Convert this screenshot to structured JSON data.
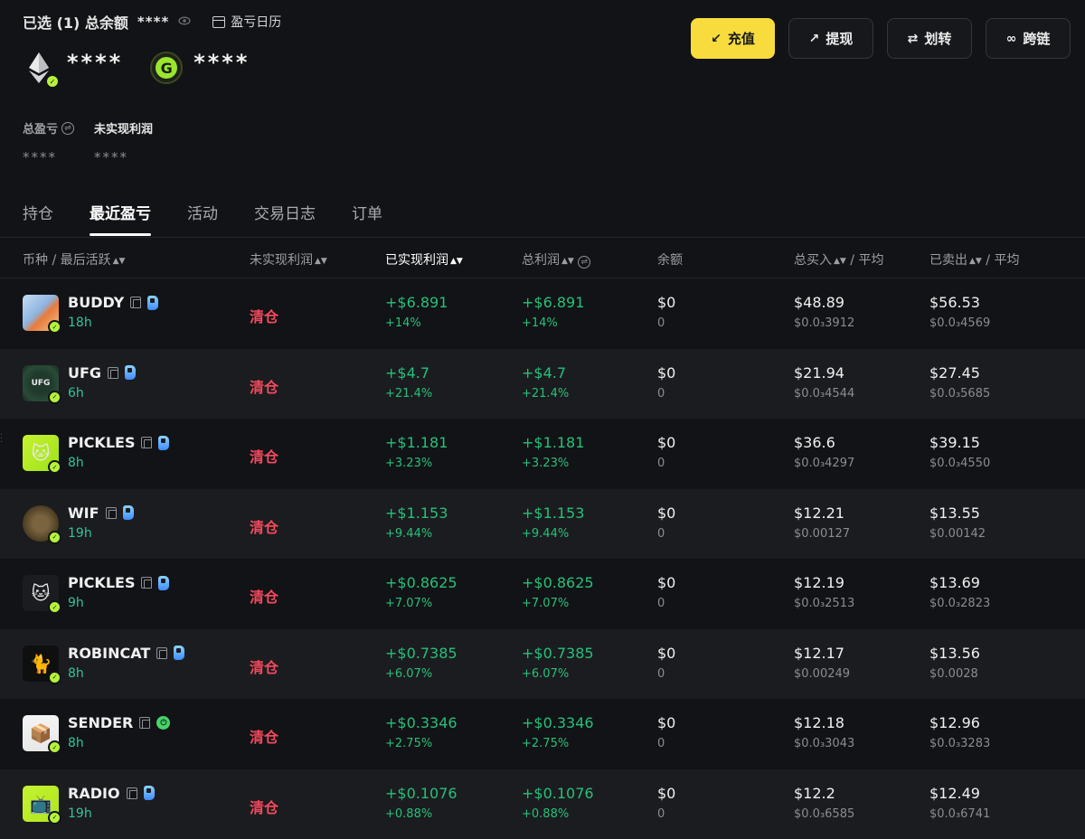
{
  "header": {
    "selected_label": "已选 (1) 总余额",
    "balance_hidden": "****",
    "eye_icon": "eye-icon",
    "calendar_label": "盈亏日历",
    "eth_balance": "****",
    "gmgn_balance": "****"
  },
  "actions": {
    "deposit": "充值",
    "withdraw": "提现",
    "transfer": "划转",
    "bridge": "跨链"
  },
  "pnl": {
    "total_label": "总盈亏",
    "total_value": "****",
    "unrealized_label": "未实现利润",
    "unrealized_value": "****"
  },
  "tabs": [
    "持仓",
    "最近盈亏",
    "活动",
    "交易日志",
    "订单"
  ],
  "active_tab": 1,
  "columns": {
    "token": "币种 / 最后活跃",
    "unrealized": "未实现利润",
    "realized": "已实现利润",
    "total": "总利润",
    "balance": "余额",
    "bought": "总买入",
    "bought_avg": "/ 平均",
    "sold": "已卖出",
    "sold_avg": "/ 平均"
  },
  "colors": {
    "accent": "#f8dc3e",
    "positive": "#26c07a",
    "negative": "#f2495e",
    "age": "#2fc59a"
  },
  "rows": [
    {
      "name": "BUDDY",
      "age": "18h",
      "chain_icon": "p-chain-icon",
      "status": "清仓",
      "realized": "+$6.891",
      "realized_pct": "+14%",
      "total": "+$6.891",
      "total_pct": "+14%",
      "balance": "$0",
      "balance_sub": "0",
      "bought": "$48.89",
      "bought_avg": "$0.0₃3912",
      "sold": "$56.53",
      "sold_avg": "$0.0₃4569"
    },
    {
      "name": "UFG",
      "age": "6h",
      "chain_icon": "p-chain-icon",
      "status": "清仓",
      "realized": "+$4.7",
      "realized_pct": "+21.4%",
      "total": "+$4.7",
      "total_pct": "+21.4%",
      "balance": "$0",
      "balance_sub": "0",
      "bought": "$21.94",
      "bought_avg": "$0.0₃4544",
      "sold": "$27.45",
      "sold_avg": "$0.0₃5685"
    },
    {
      "name": "PICKLES",
      "age": "8h",
      "chain_icon": "p-chain-icon",
      "status": "清仓",
      "realized": "+$1.181",
      "realized_pct": "+3.23%",
      "total": "+$1.181",
      "total_pct": "+3.23%",
      "balance": "$0",
      "balance_sub": "0",
      "bought": "$36.6",
      "bought_avg": "$0.0₃4297",
      "sold": "$39.15",
      "sold_avg": "$0.0₃4550"
    },
    {
      "name": "WIF",
      "age": "19h",
      "chain_icon": "p-chain-icon",
      "status": "清仓",
      "realized": "+$1.153",
      "realized_pct": "+9.44%",
      "total": "+$1.153",
      "total_pct": "+9.44%",
      "balance": "$0",
      "balance_sub": "0",
      "bought": "$12.21",
      "bought_avg": "$0.00127",
      "sold": "$13.55",
      "sold_avg": "$0.00142"
    },
    {
      "name": "PICKLES",
      "age": "9h",
      "chain_icon": "p-chain-icon",
      "status": "清仓",
      "realized": "+$0.8625",
      "realized_pct": "+7.07%",
      "total": "+$0.8625",
      "total_pct": "+7.07%",
      "balance": "$0",
      "balance_sub": "0",
      "bought": "$12.19",
      "bought_avg": "$0.0₃2513",
      "sold": "$13.69",
      "sold_avg": "$0.0₃2823"
    },
    {
      "name": "ROBINCAT",
      "age": "8h",
      "chain_icon": "p-chain-icon",
      "status": "清仓",
      "realized": "+$0.7385",
      "realized_pct": "+6.07%",
      "total": "+$0.7385",
      "total_pct": "+6.07%",
      "balance": "$0",
      "balance_sub": "0",
      "bought": "$12.17",
      "bought_avg": "$0.00249",
      "sold": "$13.56",
      "sold_avg": "$0.0028"
    },
    {
      "name": "SENDER",
      "age": "8h",
      "chain_icon": "o-chain-icon",
      "status": "清仓",
      "realized": "+$0.3346",
      "realized_pct": "+2.75%",
      "total": "+$0.3346",
      "total_pct": "+2.75%",
      "balance": "$0",
      "balance_sub": "0",
      "bought": "$12.18",
      "bought_avg": "$0.0₃3043",
      "sold": "$12.96",
      "sold_avg": "$0.0₃3283"
    },
    {
      "name": "RADIO",
      "age": "19h",
      "chain_icon": "p-chain-icon",
      "status": "清仓",
      "realized": "+$0.1076",
      "realized_pct": "+0.88%",
      "total": "+$0.1076",
      "total_pct": "+0.88%",
      "balance": "$0",
      "balance_sub": "0",
      "bought": "$12.2",
      "bought_avg": "$0.0₃6585",
      "sold": "$12.49",
      "sold_avg": "$0.0₃6741"
    }
  ]
}
